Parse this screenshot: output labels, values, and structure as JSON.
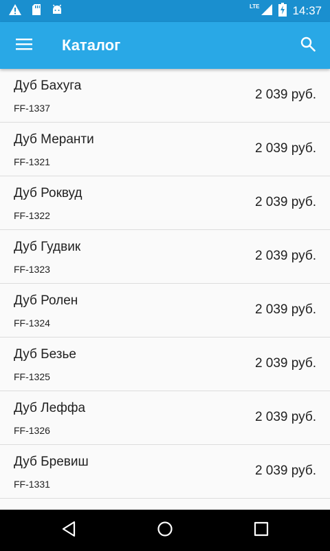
{
  "status_bar": {
    "time": "14:37",
    "network": "LTE",
    "icons": [
      "warning-icon",
      "sd-card-icon",
      "android-icon",
      "signal-icon",
      "battery-charging-icon"
    ]
  },
  "app_bar": {
    "title": "Каталог",
    "menu_icon": "menu-icon",
    "search_icon": "search-icon",
    "color": "#29a8e6"
  },
  "catalog": {
    "items": [
      {
        "name": "Дуб Бахуга",
        "code": "FF-1337",
        "price": "2 039 руб."
      },
      {
        "name": "Дуб Меранти",
        "code": "FF-1321",
        "price": "2 039 руб."
      },
      {
        "name": "Дуб Роквуд",
        "code": "FF-1322",
        "price": "2 039 руб."
      },
      {
        "name": "Дуб Гудвик",
        "code": "FF-1323",
        "price": "2 039 руб."
      },
      {
        "name": "Дуб Ролен",
        "code": "FF-1324",
        "price": "2 039 руб."
      },
      {
        "name": "Дуб Безье",
        "code": "FF-1325",
        "price": "2 039 руб."
      },
      {
        "name": "Дуб Леффа",
        "code": "FF-1326",
        "price": "2 039 руб."
      },
      {
        "name": "Дуб Бревиш",
        "code": "FF-1331",
        "price": "2 039 руб."
      }
    ]
  },
  "nav_bar": {
    "icons": [
      "back-icon",
      "home-icon",
      "recents-icon"
    ]
  }
}
